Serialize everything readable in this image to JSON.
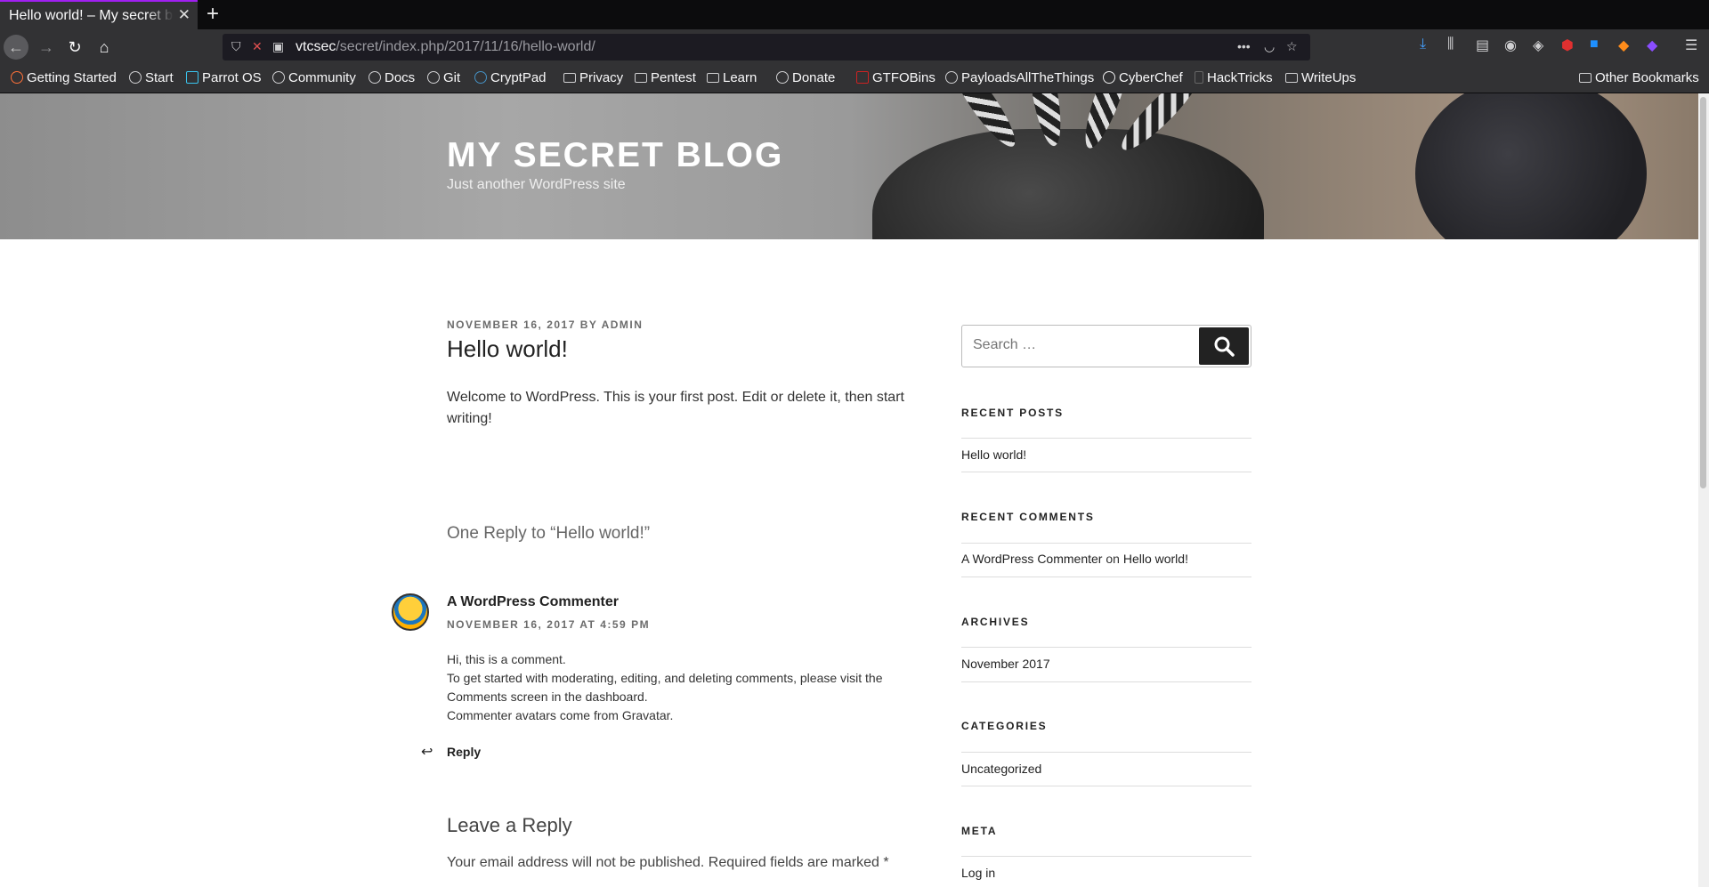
{
  "browser": {
    "tab_title": "Hello world! – My secret blog",
    "tab_close": "✕",
    "new_tab": "+",
    "url_host": "vtcsec",
    "url_path": "/secret/index.php/2017/11/16/hello-world/",
    "bookmarks": [
      "Getting Started",
      "Start",
      "Parrot OS",
      "Community",
      "Docs",
      "Git",
      "CryptPad",
      "Privacy",
      "Pentest",
      "Learn",
      "Donate",
      "GTFOBins",
      "PayloadsAllTheThings",
      "CyberChef",
      "HackTricks",
      "WriteUps"
    ],
    "other_bookmarks": "Other Bookmarks"
  },
  "header": {
    "site_title": "MY SECRET BLOG",
    "site_description": "Just another WordPress site"
  },
  "post": {
    "meta_date": "NOVEMBER 16, 2017",
    "meta_by": "BY",
    "meta_author": "ADMIN",
    "title": "Hello world!",
    "body": "Welcome to WordPress. This is your first post. Edit or delete it, then start writing!"
  },
  "comments": {
    "heading": "One Reply to “Hello world!”",
    "author": "A WordPress Commenter",
    "date": "NOVEMBER 16, 2017 AT 4:59 PM",
    "line1": "Hi, this is a comment.",
    "line2": "To get started with moderating, editing, and deleting comments, please visit the Comments screen in the dashboard.",
    "line3": "Commenter avatars come from Gravatar.",
    "reply": "Reply"
  },
  "leave_reply": {
    "title": "Leave a Reply",
    "note": "Your email address will not be published. Required fields are marked *"
  },
  "sidebar": {
    "search_placeholder": "Search …",
    "recent_posts_title": "RECENT POSTS",
    "recent_post": "Hello world!",
    "recent_comments_title": "RECENT COMMENTS",
    "recent_comment_author": "A WordPress Commenter",
    "recent_comment_on": "on",
    "recent_comment_post": "Hello world!",
    "archives_title": "ARCHIVES",
    "archive": "November 2017",
    "categories_title": "CATEGORIES",
    "category": "Uncategorized",
    "meta_title": "META",
    "meta_login": "Log in"
  }
}
